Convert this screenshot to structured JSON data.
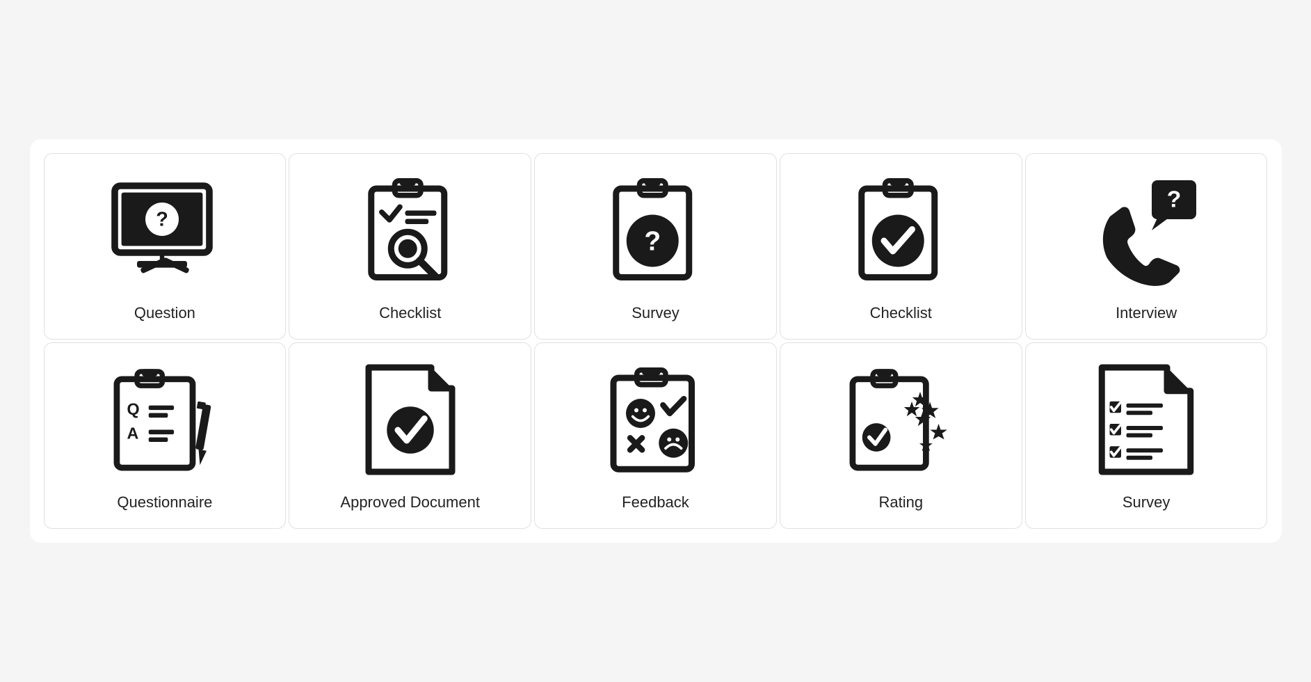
{
  "icons": [
    {
      "name": "question",
      "label": "Question",
      "id": "question-icon"
    },
    {
      "name": "checklist-1",
      "label": "Checklist",
      "id": "checklist-1-icon"
    },
    {
      "name": "survey-1",
      "label": "Survey",
      "id": "survey-1-icon"
    },
    {
      "name": "checklist-2",
      "label": "Checklist",
      "id": "checklist-2-icon"
    },
    {
      "name": "interview",
      "label": "Interview",
      "id": "interview-icon"
    },
    {
      "name": "questionnaire",
      "label": "Questionnaire",
      "id": "questionnaire-icon"
    },
    {
      "name": "approved-document",
      "label": "Approved Document",
      "id": "approved-document-icon"
    },
    {
      "name": "feedback",
      "label": "Feedback",
      "id": "feedback-icon"
    },
    {
      "name": "rating",
      "label": "Rating",
      "id": "rating-icon"
    },
    {
      "name": "survey-2",
      "label": "Survey",
      "id": "survey-2-icon"
    }
  ]
}
